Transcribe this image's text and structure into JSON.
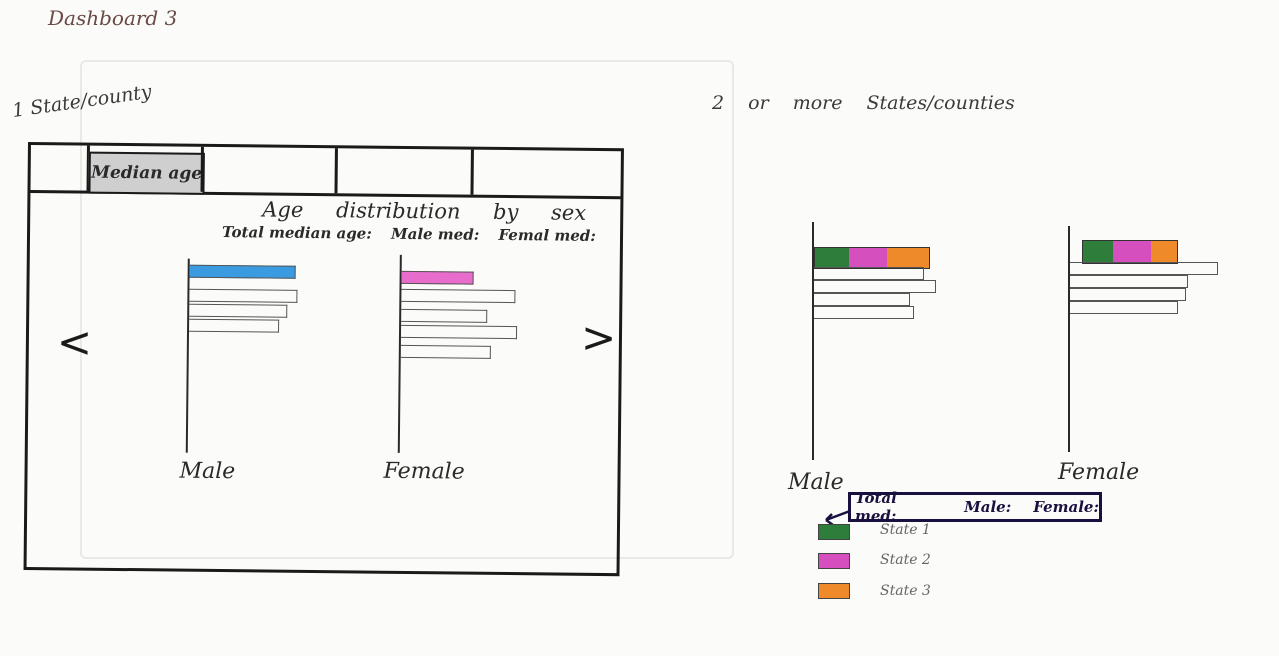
{
  "page_title": "Dashboard 3",
  "left_section": {
    "title": "1 State/county",
    "tabs": [
      "Median age",
      "",
      "",
      ""
    ],
    "chart_title": "Age distribution by sex",
    "median_labels": [
      "Total median age:",
      "Male med:",
      "Femal med:"
    ],
    "nav_prev": "<",
    "nav_next": ">",
    "male_label": "Male",
    "female_label": "Female"
  },
  "right_section": {
    "title": "2 or more States/counties",
    "male_label": "Male",
    "female_label": "Female",
    "median_box": [
      "Total med:",
      "Male:",
      "Female:"
    ],
    "legend": [
      {
        "label": "State 1",
        "color": "#2e7d3a"
      },
      {
        "label": "State 2",
        "color": "#d64fbf"
      },
      {
        "label": "State 3",
        "color": "#ef8a2b"
      }
    ]
  },
  "colors": {
    "male_highlight": "#3a9be0",
    "female_highlight": "#e86ccc",
    "ink": "#1a1a1a"
  }
}
